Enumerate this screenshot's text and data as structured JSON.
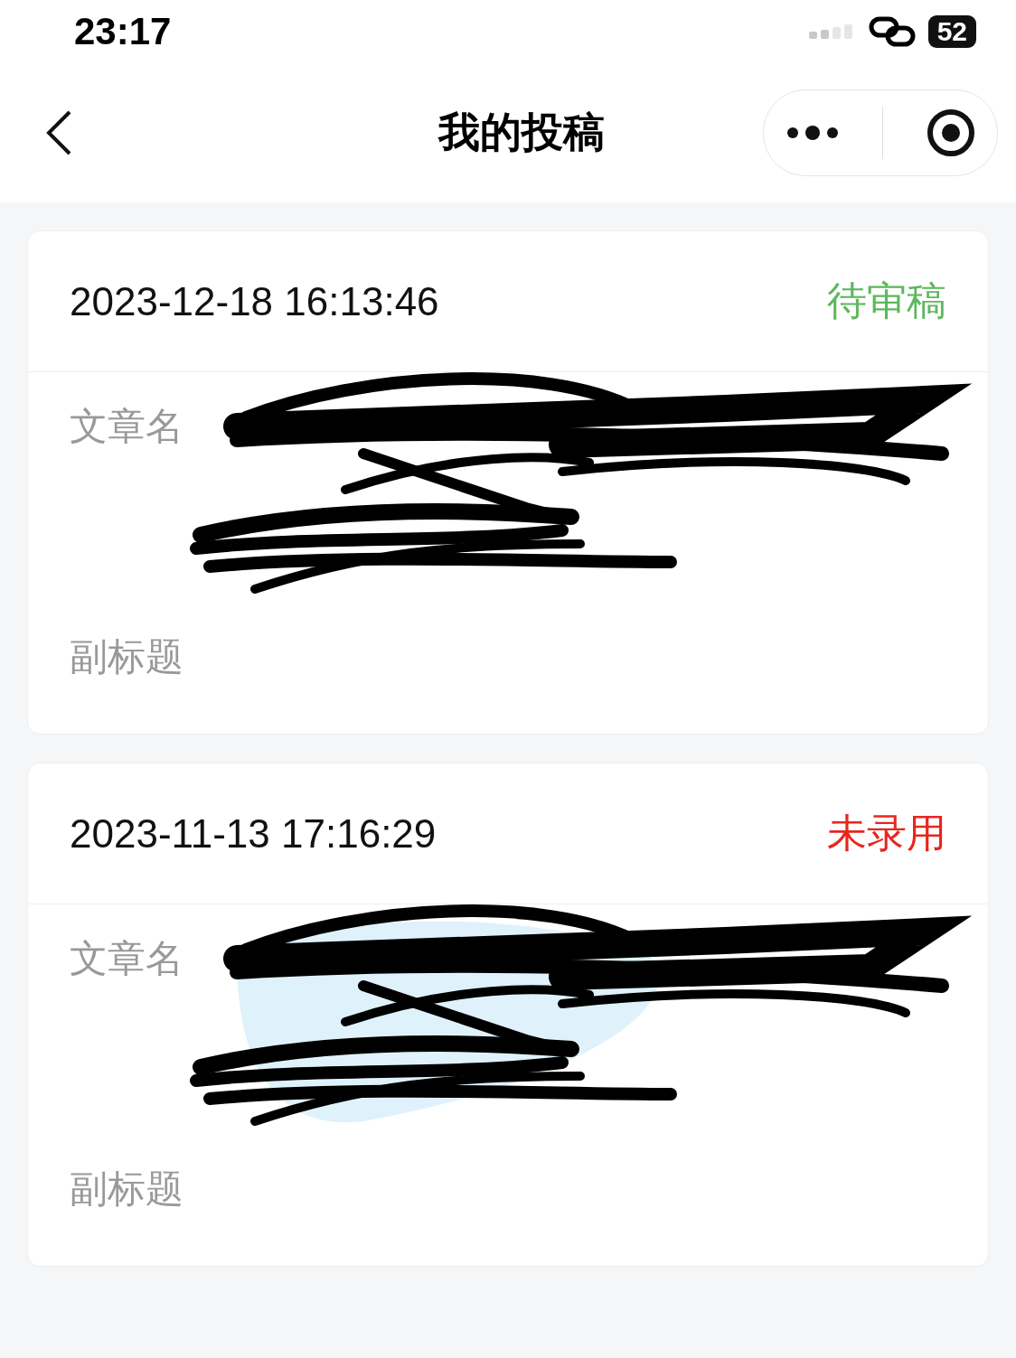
{
  "status_bar": {
    "time": "23:17",
    "battery": "52"
  },
  "nav": {
    "title": "我的投稿"
  },
  "submissions": [
    {
      "time": "2023-12-18 16:13:46",
      "status": "待审稿",
      "color": "#5cb85c",
      "fields": [
        {
          "label": "文章名",
          "kind": "scribbled"
        },
        {
          "label": "副标题",
          "kind": "plain"
        }
      ]
    },
    {
      "time": "2023-11-13 17:16:29",
      "status": "未录用",
      "color": "#e8261f",
      "fields": [
        {
          "label": "文章名",
          "kind": "scribbled"
        },
        {
          "label": "副标题",
          "kind": "plain"
        }
      ]
    }
  ]
}
